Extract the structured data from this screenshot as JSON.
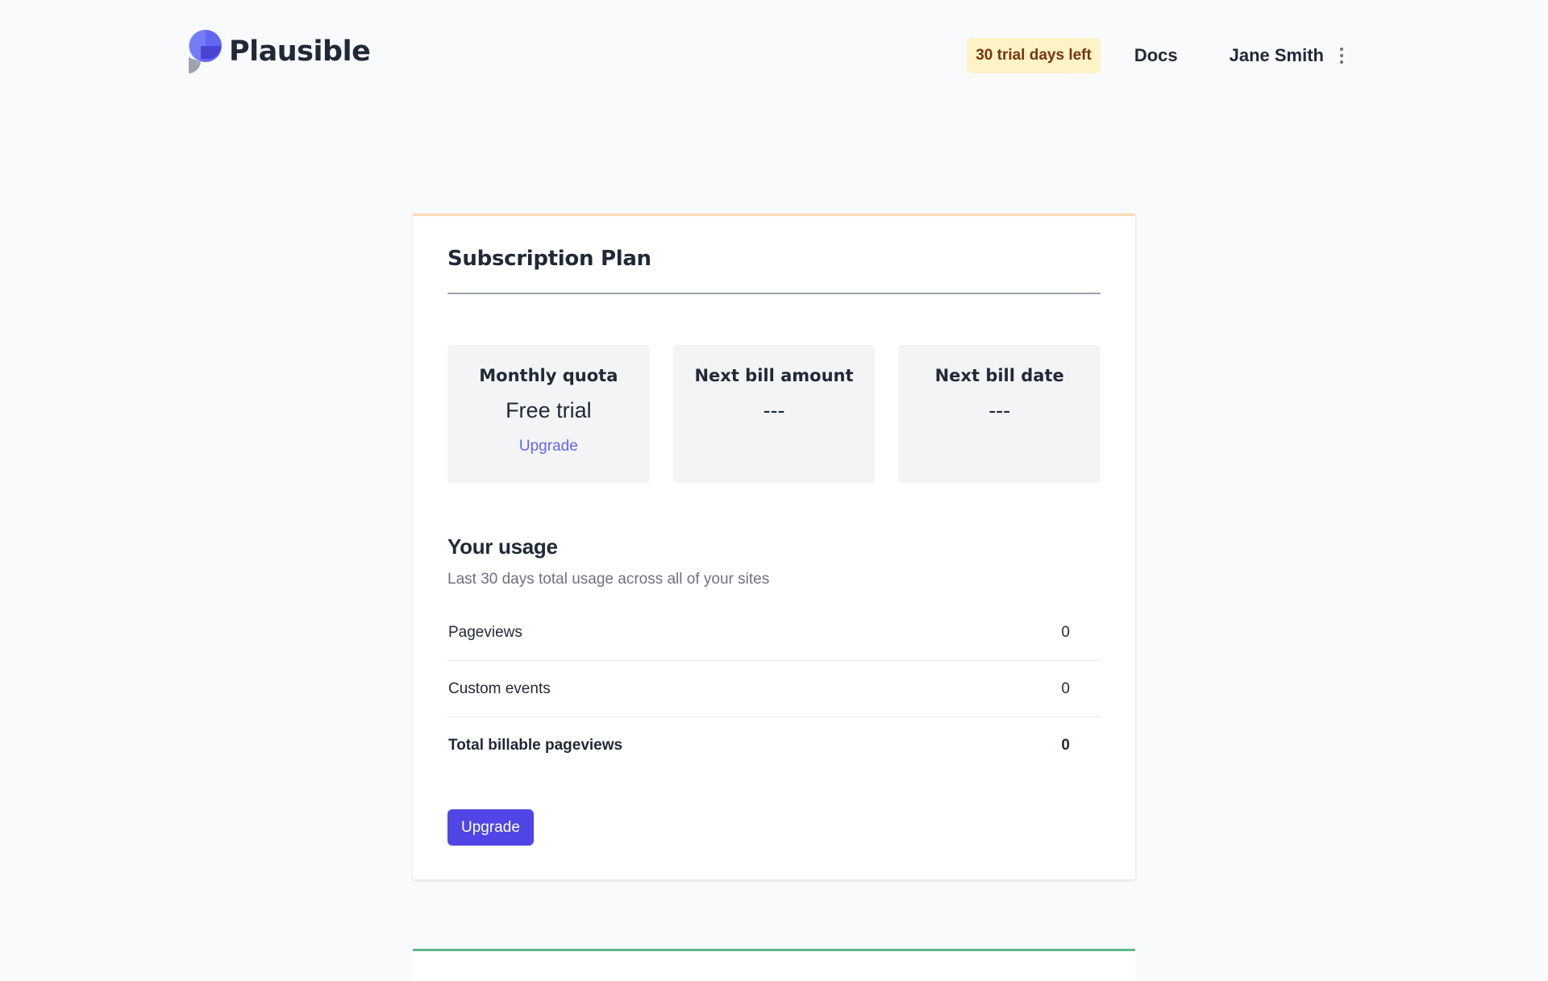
{
  "header": {
    "logo_text": "Plausible",
    "trial_badge": "30 trial days left",
    "docs_label": "Docs",
    "user_name": "Jane Smith"
  },
  "subscription": {
    "title": "Subscription Plan",
    "stats": [
      {
        "label": "Monthly quota",
        "value": "Free trial",
        "link": "Upgrade"
      },
      {
        "label": "Next bill amount",
        "value": "---"
      },
      {
        "label": "Next bill date",
        "value": "---"
      }
    ]
  },
  "usage": {
    "title": "Your usage",
    "subtitle": "Last 30 days total usage across all of your sites",
    "rows": [
      {
        "label": "Pageviews",
        "value": "0"
      },
      {
        "label": "Custom events",
        "value": "0"
      },
      {
        "label": "Total billable pageviews",
        "value": "0"
      }
    ],
    "upgrade_button": "Upgrade"
  },
  "colors": {
    "brand": "#4f46e5",
    "trial_badge_bg": "#fef3c7",
    "card_top_accent": "#fdd8b5",
    "next_card_accent": "#5fb98a"
  },
  "icons": {
    "logo": "plausible-logo-icon",
    "user_menu": "vertical-dots-icon"
  }
}
